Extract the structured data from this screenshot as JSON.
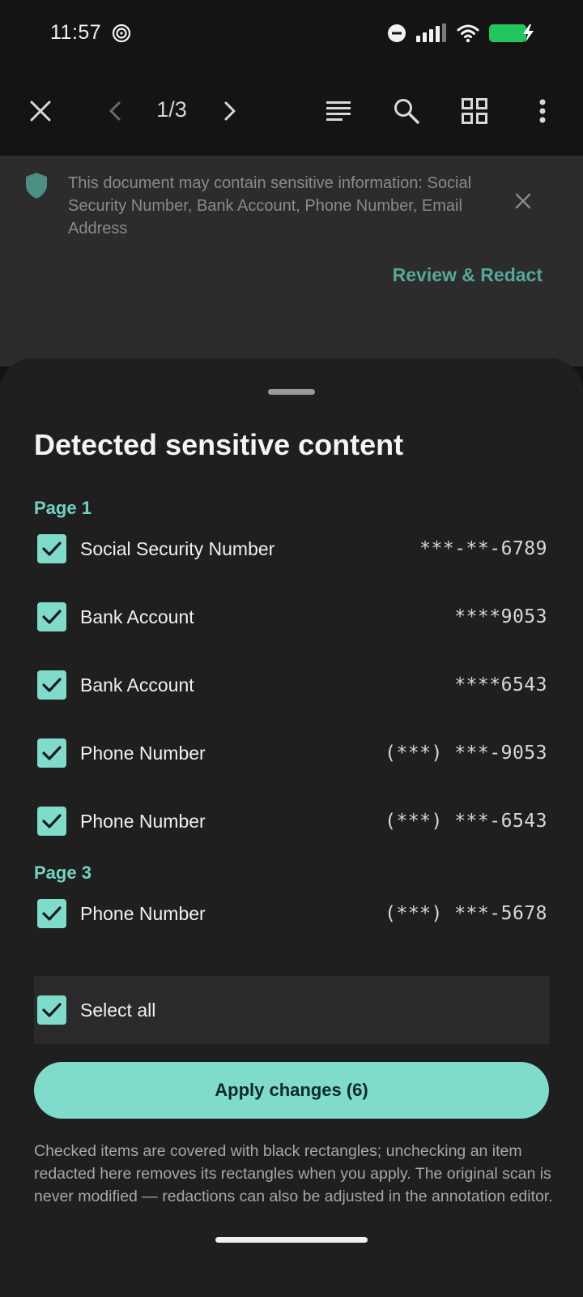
{
  "status_bar": {
    "time": "11:57",
    "icons": [
      "spiral-icon",
      "dnd-icon",
      "signal-icon",
      "wifi-icon",
      "battery-charging-icon"
    ],
    "battery_color": "#22c55e"
  },
  "toolbar": {
    "page_indicator": "1/3",
    "icons": [
      "close-icon",
      "prev-page-icon",
      "next-page-icon",
      "text-view-icon",
      "search-icon",
      "grid-view-icon",
      "more-icon"
    ]
  },
  "banner": {
    "message": "This document may contain sensitive information: Social Security Number, Bank Account, Phone Number, Email Address",
    "action_label": "Review & Redact"
  },
  "sheet": {
    "title": "Detected sensitive content",
    "sections": [
      {
        "heading": "Page 1",
        "items": [
          {
            "label": "Social Security Number",
            "value": "***-**-6789",
            "checked": true
          },
          {
            "label": "Bank Account",
            "value": "****9053",
            "checked": true
          },
          {
            "label": "Bank Account",
            "value": "****6543",
            "checked": true
          },
          {
            "label": "Phone Number",
            "value": "(***) ***-9053",
            "checked": true
          },
          {
            "label": "Phone Number",
            "value": "(***) ***-6543",
            "checked": true
          }
        ]
      },
      {
        "heading": "Page 3",
        "items": [
          {
            "label": "Phone Number",
            "value": "(***) ***-5678",
            "checked": true
          }
        ]
      }
    ],
    "select_all_label": "Select all",
    "apply_label": "Apply changes (6)",
    "footnote": "Checked items are covered with black rectangles; unchecking an item redacted here removes its rectangles when you apply. The original scan is never modified — redactions can also be adjusted in the annotation editor."
  },
  "colors": {
    "accent": "#7fdccb",
    "section_heading": "#72d3c2",
    "sheet_background": "#1f1f1f"
  }
}
